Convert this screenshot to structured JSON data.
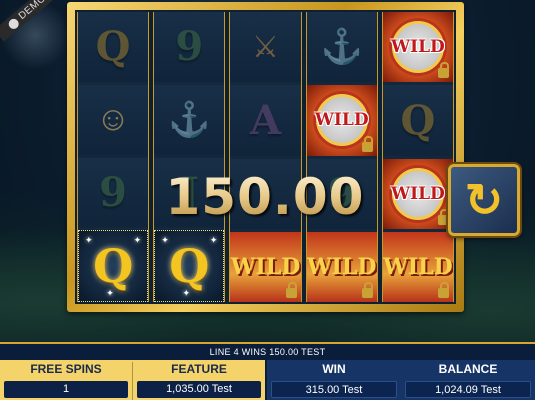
{
  "demo_badge": "DEMO",
  "reels": [
    [
      {
        "type": "letter",
        "symbol": "Q",
        "icon": "q-symbol",
        "dim": true
      },
      {
        "type": "picture",
        "icon": "warrior-girl-symbol",
        "dim": true
      },
      {
        "type": "letter",
        "symbol": "9",
        "icon": "nine-symbol",
        "dim": true
      },
      {
        "type": "win-letter",
        "symbol": "Q",
        "icon": "q-symbol"
      }
    ],
    [
      {
        "type": "letter",
        "symbol": "9",
        "icon": "nine-symbol",
        "dim": true
      },
      {
        "type": "picture",
        "icon": "dragon-ship-symbol",
        "dim": true
      },
      {
        "type": "letter",
        "symbol": "J",
        "icon": "j-symbol",
        "dim": true
      },
      {
        "type": "win-letter",
        "symbol": "Q",
        "icon": "q-symbol"
      }
    ],
    [
      {
        "type": "picture",
        "icon": "viking-warrior-symbol",
        "dim": true
      },
      {
        "type": "letter",
        "symbol": "A",
        "icon": "a-symbol",
        "dim": true
      },
      {
        "type": "letter",
        "symbol": "",
        "icon": "blank-symbol",
        "dim": true
      },
      {
        "type": "wild-full",
        "symbol": "WILD",
        "icon": "wild-symbol"
      }
    ],
    [
      {
        "type": "picture",
        "icon": "dragon-ship-symbol",
        "dim": true
      },
      {
        "type": "wild",
        "symbol": "WILD",
        "icon": "wild-symbol"
      },
      {
        "type": "letter",
        "symbol": "9",
        "icon": "nine-symbol",
        "dim": true
      },
      {
        "type": "wild-full",
        "symbol": "WILD",
        "icon": "wild-symbol"
      }
    ],
    [
      {
        "type": "wild",
        "symbol": "WILD",
        "icon": "wild-symbol"
      },
      {
        "type": "letter",
        "symbol": "Q",
        "icon": "q-symbol",
        "dim": true
      },
      {
        "type": "wild",
        "symbol": "WILD",
        "icon": "wild-symbol"
      },
      {
        "type": "wild-full",
        "symbol": "WILD",
        "icon": "wild-symbol"
      }
    ]
  ],
  "win_amount": "150.00",
  "spin_icon": "respin-arrow-icon",
  "line_message": "LINE 4 WINS 150.00 TEST",
  "free_spins": {
    "label": "FREE SPINS",
    "value": "1"
  },
  "feature": {
    "label": "FEATURE",
    "value": "1,035.00 Test"
  },
  "win": {
    "label": "WIN",
    "value": "315.00 Test"
  },
  "balance": {
    "label": "BALANCE",
    "value": "1,024.09 Test"
  },
  "colors": {
    "gold": "#d9a934",
    "navy": "#0a1d3a",
    "panel_yellow": "#f4d46a",
    "wild_red": "#c1351a"
  }
}
